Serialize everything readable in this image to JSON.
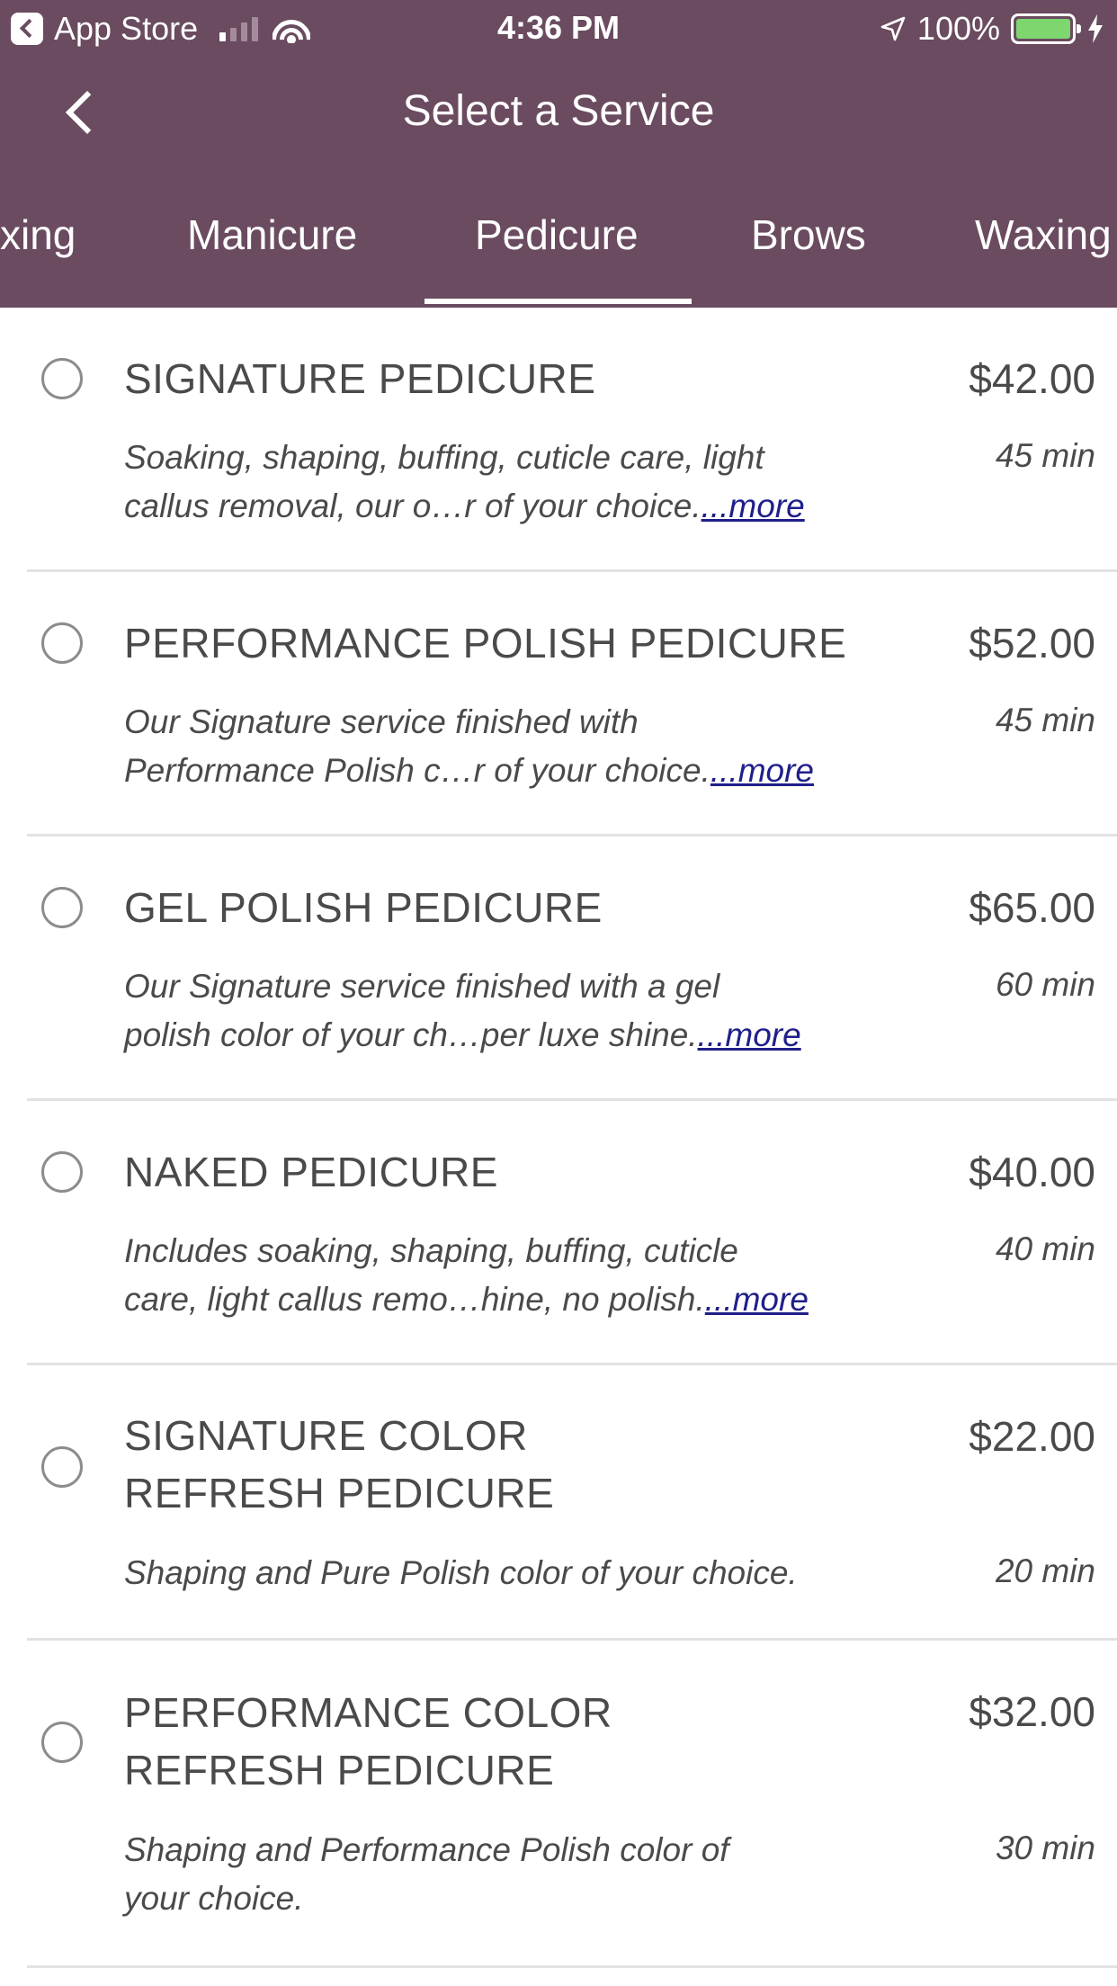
{
  "status_bar": {
    "back_app": "App Store",
    "time": "4:36 PM",
    "battery": "100%"
  },
  "nav": {
    "title": "Select a Service"
  },
  "tabs": [
    "xing",
    "Manicure",
    "Pedicure",
    "Brows",
    "Waxing"
  ],
  "selected_tab": "Pedicure",
  "services": [
    {
      "name": "SIGNATURE PEDICURE",
      "price": "$42.00",
      "duration": "45 min",
      "desc_line1": "Soaking, shaping, buffing, cuticle care, light",
      "desc_line2": "callus removal, our o…r of your choice.",
      "more": "...more"
    },
    {
      "name": "PERFORMANCE POLISH PEDICURE",
      "price": "$52.00",
      "duration": "45 min",
      "desc_line1": "Our Signature service finished with",
      "desc_line2": "Performance Polish c…r of your choice.",
      "more": "...more"
    },
    {
      "name": "GEL POLISH PEDICURE",
      "price": "$65.00",
      "duration": "60 min",
      "desc_line1": "Our Signature service finished with a gel",
      "desc_line2": "polish color of your ch…per luxe shine.",
      "more": "...more"
    },
    {
      "name": "NAKED PEDICURE",
      "price": "$40.00",
      "duration": "40 min",
      "desc_line1": "Includes soaking, shaping, buffing, cuticle",
      "desc_line2": "care, light callus remo…hine, no polish.",
      "more": "...more"
    },
    {
      "name_line1": "SIGNATURE COLOR",
      "name_line2": "REFRESH PEDICURE",
      "price": "$22.00",
      "duration": "20 min",
      "desc_line1": "Shaping and Pure Polish color of your choice."
    },
    {
      "name_line1": "PERFORMANCE COLOR",
      "name_line2": "REFRESH PEDICURE",
      "price": "$32.00",
      "duration": "30 min",
      "desc_line1": "Shaping and Performance Polish color of",
      "desc_line2": "your choice."
    }
  ]
}
